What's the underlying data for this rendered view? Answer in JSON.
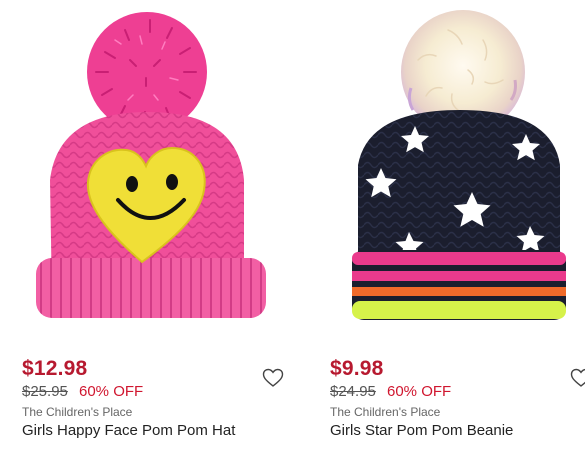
{
  "colors": {
    "price": "#b7192f",
    "discount": "#d0162f",
    "brand_text": "#666666",
    "title_text": "#222222"
  },
  "products": [
    {
      "image_icon": "pink-smiley-pom-pom-hat-image",
      "price": "$12.98",
      "original_price": "$25.95",
      "discount": "60% OFF",
      "brand": "The Children's Place",
      "name": "Girls Happy Face Pom Pom Hat",
      "favorite_icon": "heart-outline-icon"
    },
    {
      "image_icon": "black-star-pom-pom-beanie-image",
      "price": "$9.98",
      "original_price": "$24.95",
      "discount": "60% OFF",
      "brand": "The Children's Place",
      "name": "Girls Star Pom Pom Beanie",
      "favorite_icon": "heart-outline-icon"
    }
  ]
}
